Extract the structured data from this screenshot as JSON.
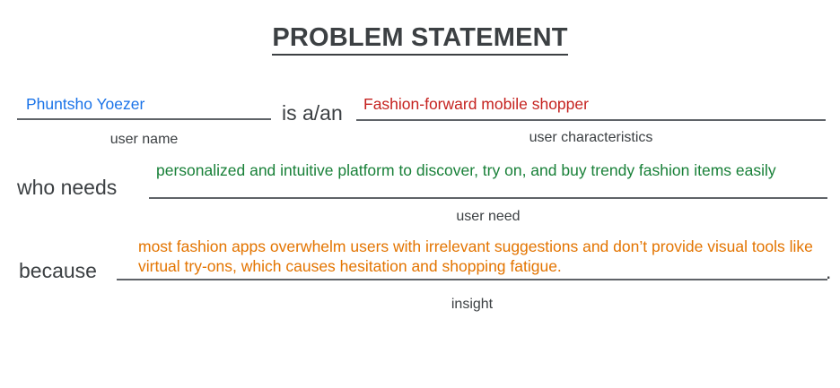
{
  "title": "PROBLEM STATEMENT",
  "row1": {
    "user_name": "Phuntsho Yoezer",
    "user_name_caption": "user name",
    "connector": "is a/an",
    "user_characteristics": "Fashion-forward mobile shopper",
    "user_characteristics_caption": "user characteristics"
  },
  "row2": {
    "connector": "who needs",
    "user_need": "personalized and intuitive platform to discover, try on, and buy trendy fashion items easily",
    "user_need_caption": "user need"
  },
  "row3": {
    "connector": "because",
    "insight": "most fashion apps overwhelm users with irrelevant suggestions and don’t provide visual tools like virtual try-ons, which causes hesitation and shopping fatigue.",
    "insight_caption": "insight",
    "end_mark": "."
  },
  "colors": {
    "user_name": "#1a73e8",
    "user_characteristics": "#c5221f",
    "user_need": "#188038",
    "insight": "#e37400",
    "text": "#3c4043"
  }
}
